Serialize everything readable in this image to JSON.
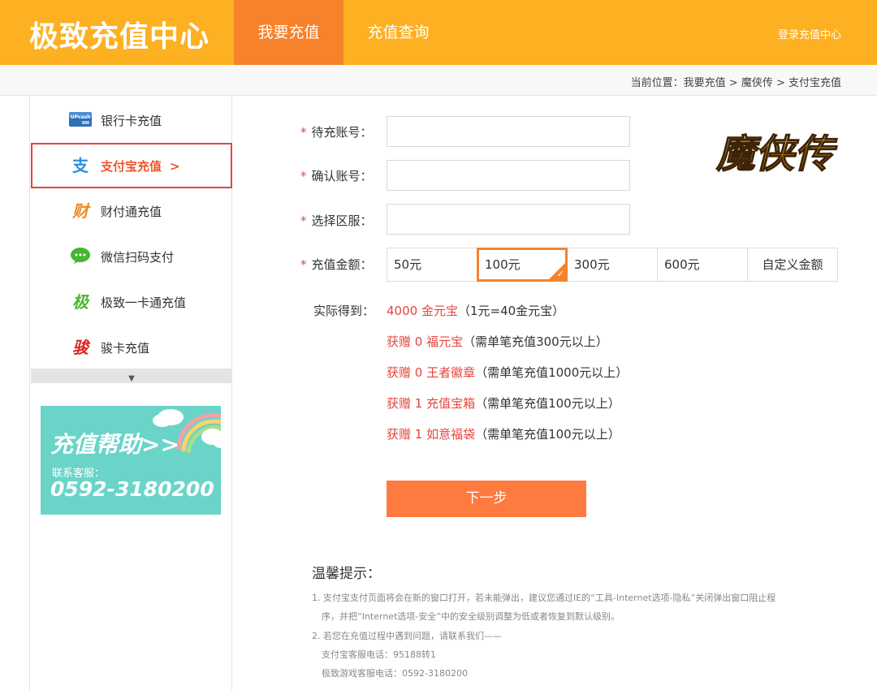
{
  "header": {
    "logo": "极致充值中心",
    "tabs": [
      {
        "label": "我要充值",
        "active": true
      },
      {
        "label": "充值查询",
        "active": false
      }
    ],
    "login_link": "登录充值中心"
  },
  "breadcrumb": "当前位置：我要充值 > 魔侠传 > 支付宝充值",
  "sidebar": {
    "items": [
      {
        "label": "银行卡充值",
        "icon": "upcash-bank-card-icon",
        "active": false
      },
      {
        "label": "支付宝充值",
        "icon": "alipay-icon",
        "active": true,
        "arrow": ">"
      },
      {
        "label": "财付通充值",
        "icon": "tenpay-icon",
        "active": false
      },
      {
        "label": "微信扫码支付",
        "icon": "wechat-icon",
        "active": false
      },
      {
        "label": "极致一卡通充值",
        "icon": "jizhi-card-icon",
        "active": false
      },
      {
        "label": "骏卡充值",
        "icon": "junka-icon",
        "active": false
      }
    ],
    "icon_glyphs": {
      "alipay": "支",
      "tenpay": "财",
      "jizhi": "极",
      "junka": "骏",
      "upcash": "UPcash"
    },
    "help_banner": {
      "title": "充值帮助>>",
      "contact_label": "联系客服：",
      "phone": "0592-3180200"
    }
  },
  "game_logo_text": "魔侠传",
  "form": {
    "required_mark": "*",
    "account_label": "待充账号：",
    "account_value": "",
    "confirm_label": "确认账号：",
    "confirm_value": "",
    "server_label": "选择区服：",
    "server_value": "",
    "amount_label": "充值金额：",
    "amount_options": [
      "50元",
      "100元",
      "300元",
      "600元",
      "自定义金额"
    ],
    "selected_amount": "100元"
  },
  "gain": {
    "label": "实际得到：",
    "lines": [
      {
        "highlight": "4000 金元宝",
        "note": "（1元=40金元宝）"
      },
      {
        "highlight": "获赠 0 福元宝",
        "note": "（需单笔充值300元以上）"
      },
      {
        "highlight": "获赠 0 王者徽章",
        "note": "（需单笔充值1000元以上）"
      },
      {
        "highlight": "获赠 1 充值宝箱",
        "note": "（需单笔充值100元以上）"
      },
      {
        "highlight": "获赠 1 如意福袋",
        "note": "（需单笔充值100元以上）"
      }
    ]
  },
  "next_button": "下一步",
  "tips": {
    "title": "温馨提示：",
    "lines": [
      "1. 支付宝支付页面将会在新的窗口打开，若未能弹出，建议您通过IE的“工具-Internet选项-隐私”关闭弹出窗口阻止程",
      "序，并把“Internet选项-安全”中的安全级别调整为低或者恢复到默认级别。",
      "2. 若您在充值过程中遇到问题，请联系我们——",
      "支付宝客服电话：95188转1",
      "极致游戏客服电话：0592-3180200"
    ]
  },
  "colors": {
    "header_bg": "#fdb022",
    "active_tab_bg": "#f7822c",
    "accent_red": "#e6453e",
    "button_orange": "#ff7a3f",
    "banner_teal": "#6ad4c9"
  }
}
